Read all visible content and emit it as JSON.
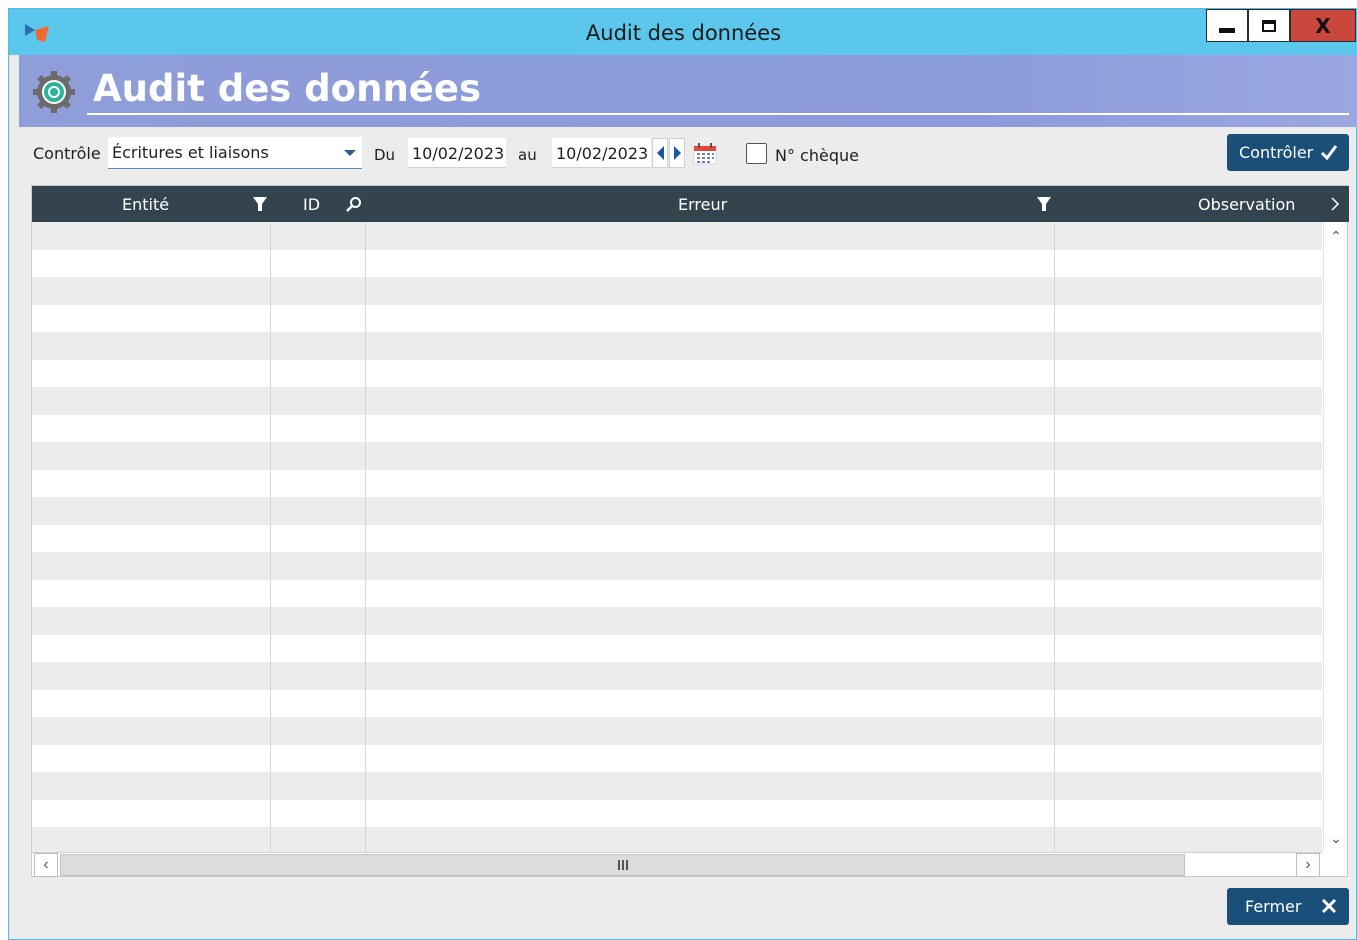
{
  "window": {
    "title": "Audit des données"
  },
  "header": {
    "title": "Audit des données"
  },
  "toolbar": {
    "controle_label": "Contrôle",
    "controle_value": "Écritures et liaisons",
    "du_label": "Du",
    "date_from": "10/02/2023",
    "au_label": "au",
    "date_to": "10/02/2023",
    "cheque_label": "N° chèque",
    "cheque_checked": false,
    "controler_label": "Contrôler"
  },
  "grid": {
    "columns": [
      "Entité",
      "ID",
      "Erreur",
      "Observation"
    ],
    "rows": []
  },
  "footer": {
    "fermer_label": "Fermer"
  },
  "colors": {
    "titlebar": "#5cc7ec",
    "header_band": "#8f9ed8",
    "grid_header": "#34444f",
    "button": "#1a4f7a",
    "close_button": "#c9473d"
  }
}
